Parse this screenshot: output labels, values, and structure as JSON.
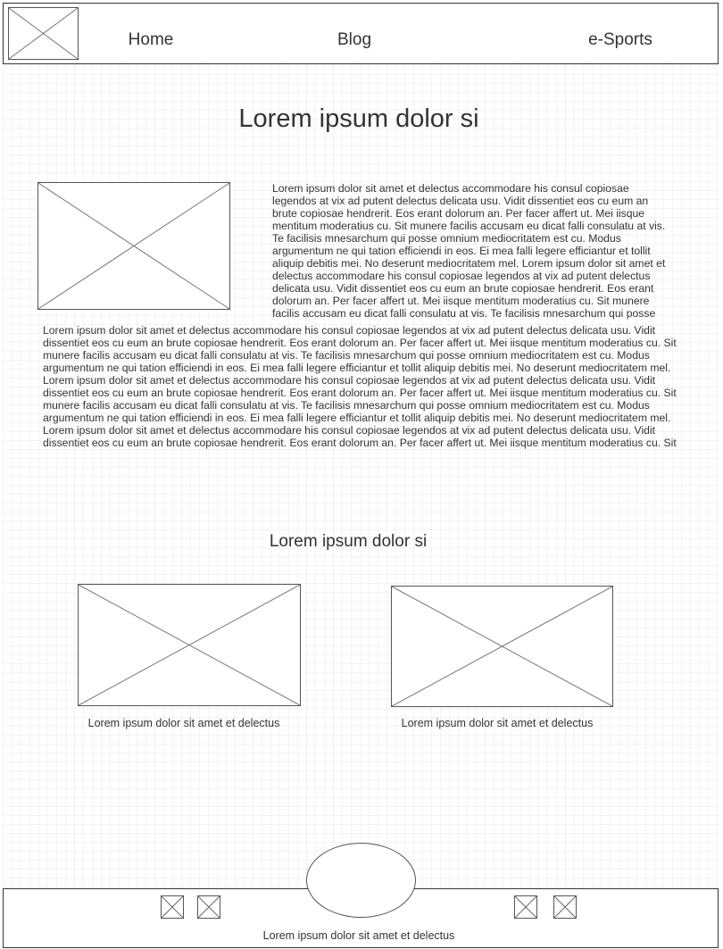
{
  "nav": {
    "logo": "image-placeholder-icon",
    "items": [
      {
        "label": "Home"
      },
      {
        "label": "Blog"
      },
      {
        "label": "e-Sports"
      }
    ]
  },
  "main": {
    "title": "Lorem ipsum dolor si",
    "intro_image": "image-placeholder-icon",
    "paragraph_right": "Lorem ipsum dolor sit amet et delectus accommodare his consul copiosae legendos at vix ad putent delectus delicata usu. Vidit dissentiet eos cu eum an brute copiosae hendrerit. Eos erant dolorum an. Per facer affert ut. Mei iisque mentitum moderatius cu. Sit munere facilis accusam eu dicat falli consulatu at vis. Te facilisis mnesarchum qui posse omnium mediocritatem est cu. Modus argumentum ne qui tation efficiendi in eos. Ei mea falli legere efficiantur et tollit aliquip debitis mei. No deserunt mediocritatem mel. Lorem ipsum dolor sit amet et delectus accommodare his consul copiosae legendos at vix ad putent delectus delicata usu. Vidit dissentiet eos cu eum an brute copiosae hendrerit. Eos erant dolorum an. Per facer affert ut. Mei iisque mentitum moderatius cu. Sit munere facilis accusam eu dicat falli consulatu at vis. Te facilisis mnesarchum qui posse",
    "paragraph_full": "Lorem ipsum dolor sit amet et delectus accommodare his consul copiosae legendos at vix ad putent delectus delicata usu. Vidit dissentiet eos cu eum an brute copiosae hendrerit. Eos erant dolorum an. Per facer affert ut. Mei iisque mentitum moderatius cu. Sit munere facilis accusam eu dicat falli consulatu at vis. Te facilisis mnesarchum qui posse omnium mediocritatem est cu. Modus argumentum ne qui tation efficiendi in eos. Ei mea falli legere efficiantur et tollit aliquip debitis mei. No deserunt mediocritatem mel. Lorem ipsum dolor sit amet et delectus accommodare his consul copiosae legendos at vix ad putent delectus delicata usu. Vidit dissentiet eos cu eum an brute copiosae hendrerit. Eos erant dolorum an. Per facer affert ut. Mei iisque mentitum moderatius cu. Sit munere facilis accusam eu dicat falli consulatu at vis. Te facilisis mnesarchum qui posse omnium mediocritatem est cu. Modus argumentum ne qui tation efficiendi in eos. Ei mea falli legere efficiantur et tollit aliquip debitis mei. No deserunt mediocritatem mel. Lorem ipsum dolor sit amet et delectus accommodare his consul copiosae legendos at vix ad putent delectus delicata usu. Vidit dissentiet eos cu eum an brute copiosae hendrerit. Eos erant dolorum an. Per facer affert ut. Mei iisque mentitum moderatius cu. Sit",
    "subtitle": "Lorem ipsum dolor si",
    "cards": [
      {
        "image": "image-placeholder-icon",
        "caption": "Lorem ipsum dolor sit amet et delectus"
      },
      {
        "image": "image-placeholder-icon",
        "caption": "Lorem ipsum dolor sit amet et delectus"
      }
    ]
  },
  "footer": {
    "social_icons": [
      "image-placeholder-icon",
      "image-placeholder-icon",
      "image-placeholder-icon",
      "image-placeholder-icon"
    ],
    "text": "Lorem ipsum dolor sit amet et delectus"
  },
  "colors": {
    "border": "#333333",
    "placeholder_line": "#555555",
    "text": "#333333",
    "grid": "#e6e6e6"
  }
}
